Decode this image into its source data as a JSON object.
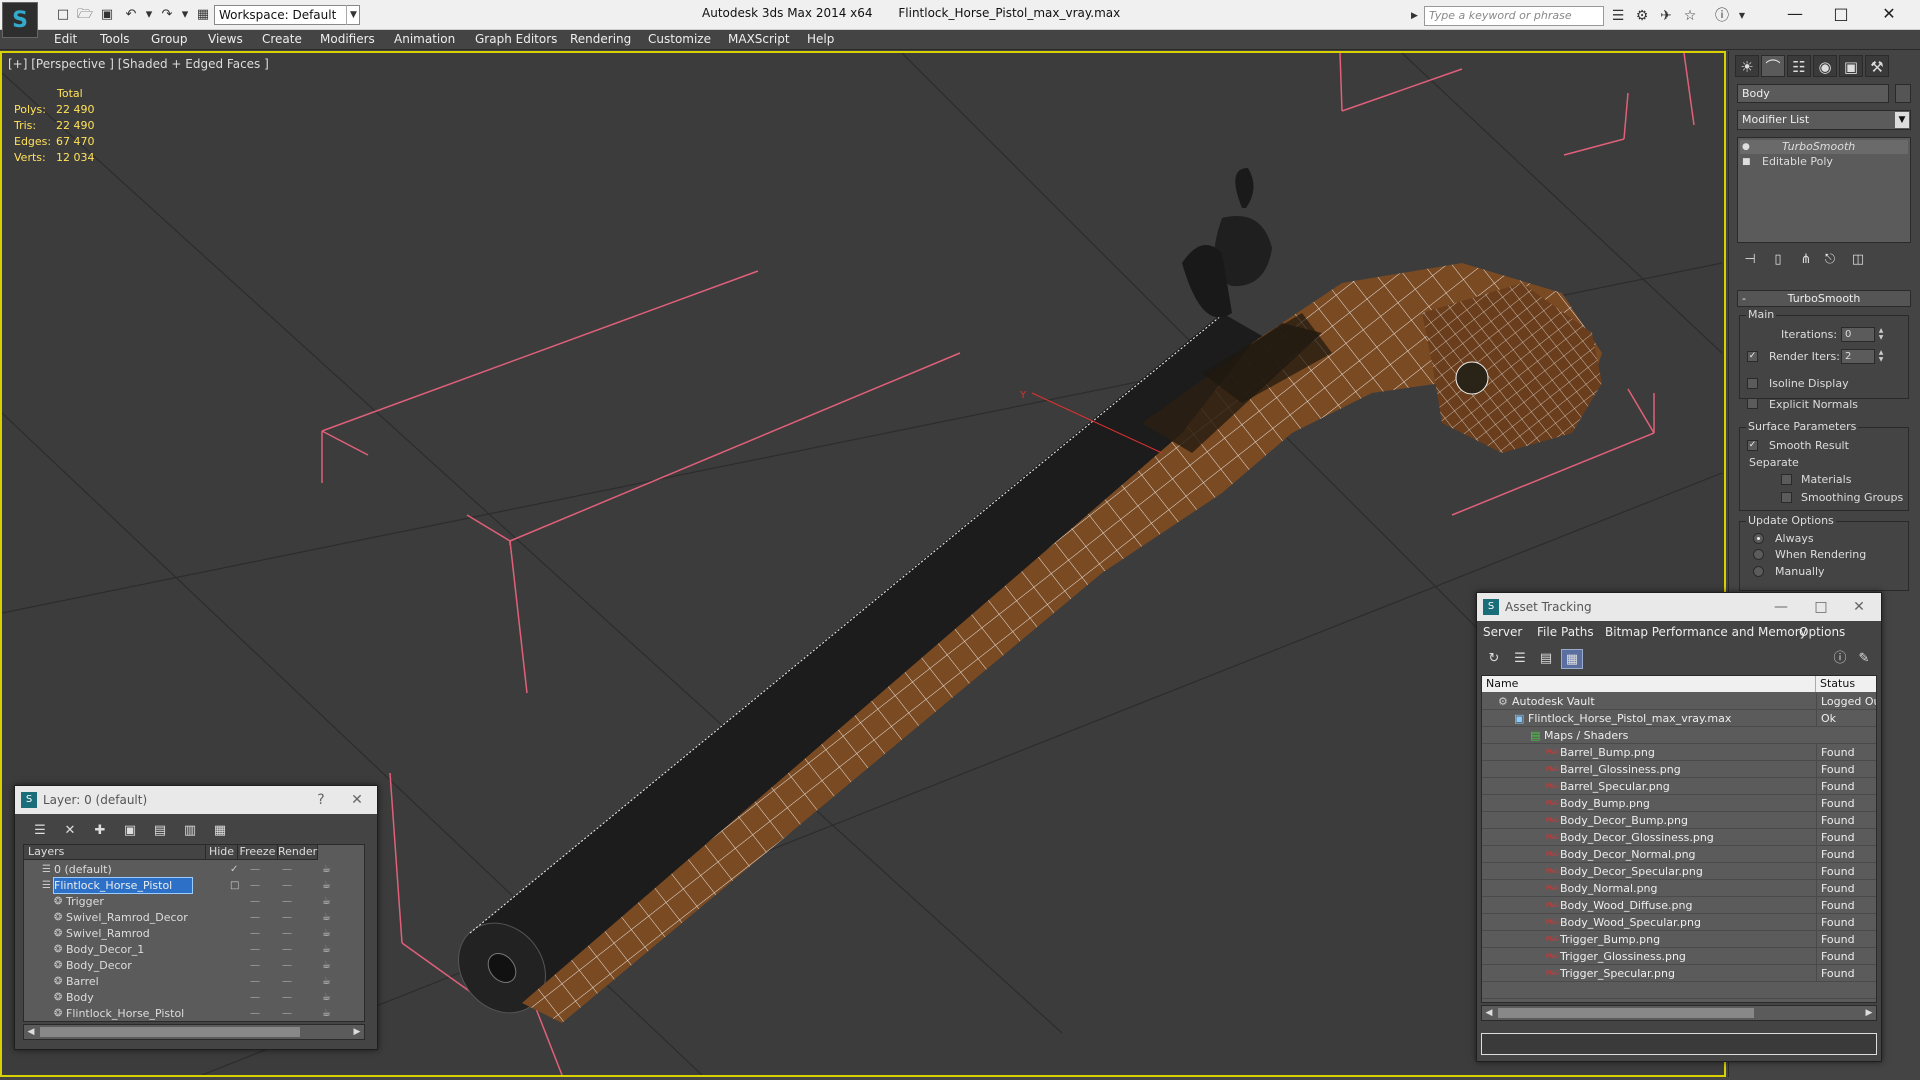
{
  "titlebar": {
    "workspace": "Workspace: Default",
    "app_name": "Autodesk 3ds Max  2014 x64",
    "file_name": "Flintlock_Horse_Pistol_max_vray.max",
    "search_placeholder": "Type a keyword or phrase"
  },
  "menu": [
    "Edit",
    "Tools",
    "Group",
    "Views",
    "Create",
    "Modifiers",
    "Animation",
    "Graph Editors",
    "Rendering",
    "Customize",
    "MAXScript",
    "Help"
  ],
  "viewport": {
    "label": "[+] [Perspective ] [Shaded + Edged Faces ]",
    "stats": {
      "header": "Total",
      "rows": [
        {
          "label": "Polys:",
          "value": "22 490"
        },
        {
          "label": "Tris:",
          "value": "22 490"
        },
        {
          "label": "Edges:",
          "value": "67 470"
        },
        {
          "label": "Verts:",
          "value": "12 034"
        }
      ]
    },
    "colors": {
      "wood": "#7a4a22",
      "barrel": "#1c1c1c",
      "wire": "#f4f4f4",
      "grid": "#2c2c2c",
      "bbox": "#e0607a",
      "border": "#d8d000"
    }
  },
  "command_panel": {
    "object_name": "Body",
    "modifier_list": "Modifier List",
    "stack": [
      "TurboSmooth",
      "Editable Poly"
    ],
    "rollout_title": "TurboSmooth",
    "main_group": "Main",
    "iterations_label": "Iterations:",
    "iterations_value": "0",
    "render_iters_label": "Render Iters:",
    "render_iters_value": "2",
    "isoline": "Isoline Display",
    "explicit_normals": "Explicit Normals",
    "surface_group": "Surface Parameters",
    "smooth_result": "Smooth Result",
    "separate": "Separate",
    "materials": "Materials",
    "smoothing_groups": "Smoothing Groups",
    "update_group": "Update Options",
    "always": "Always",
    "when_rendering": "When Rendering",
    "manually": "Manually"
  },
  "layer_dialog": {
    "title": "Layer: 0 (default)",
    "help": "?",
    "columns": [
      "Layers",
      "Hide",
      "Freeze",
      "Render"
    ],
    "rows": [
      {
        "name": "0 (default)",
        "indent": 0
      },
      {
        "name": "Flintlock_Horse_Pistol",
        "indent": 0,
        "selected": true
      },
      {
        "name": "Trigger",
        "indent": 1
      },
      {
        "name": "Swivel_Ramrod_Decor",
        "indent": 1
      },
      {
        "name": "Swivel_Ramrod",
        "indent": 1
      },
      {
        "name": "Body_Decor_1",
        "indent": 1
      },
      {
        "name": "Body_Decor",
        "indent": 1
      },
      {
        "name": "Barrel",
        "indent": 1
      },
      {
        "name": "Body",
        "indent": 1
      },
      {
        "name": "Flintlock_Horse_Pistol",
        "indent": 1
      }
    ]
  },
  "asset_dialog": {
    "title": "Asset Tracking",
    "menu": [
      "Server",
      "File",
      "Paths",
      "Bitmap Performance and Memory",
      "Options"
    ],
    "columns": [
      "Name",
      "Status"
    ],
    "rows": [
      {
        "name": "Autodesk Vault",
        "status": "Logged Out",
        "indent": 0
      },
      {
        "name": "Flintlock_Horse_Pistol_max_vray.max",
        "status": "Ok",
        "indent": 1
      },
      {
        "name": "Maps / Shaders",
        "status": "",
        "indent": 2
      },
      {
        "name": "Barrel_Bump.png",
        "status": "Found",
        "indent": 3
      },
      {
        "name": "Barrel_Glossiness.png",
        "status": "Found",
        "indent": 3
      },
      {
        "name": "Barrel_Specular.png",
        "status": "Found",
        "indent": 3
      },
      {
        "name": "Body_Bump.png",
        "status": "Found",
        "indent": 3
      },
      {
        "name": "Body_Decor_Bump.png",
        "status": "Found",
        "indent": 3
      },
      {
        "name": "Body_Decor_Glossiness.png",
        "status": "Found",
        "indent": 3
      },
      {
        "name": "Body_Decor_Normal.png",
        "status": "Found",
        "indent": 3
      },
      {
        "name": "Body_Decor_Specular.png",
        "status": "Found",
        "indent": 3
      },
      {
        "name": "Body_Normal.png",
        "status": "Found",
        "indent": 3
      },
      {
        "name": "Body_Wood_Diffuse.png",
        "status": "Found",
        "indent": 3
      },
      {
        "name": "Body_Wood_Specular.png",
        "status": "Found",
        "indent": 3
      },
      {
        "name": "Trigger_Bump.png",
        "status": "Found",
        "indent": 3
      },
      {
        "name": "Trigger_Glossiness.png",
        "status": "Found",
        "indent": 3
      },
      {
        "name": "Trigger_Specular.png",
        "status": "Found",
        "indent": 3
      }
    ]
  }
}
